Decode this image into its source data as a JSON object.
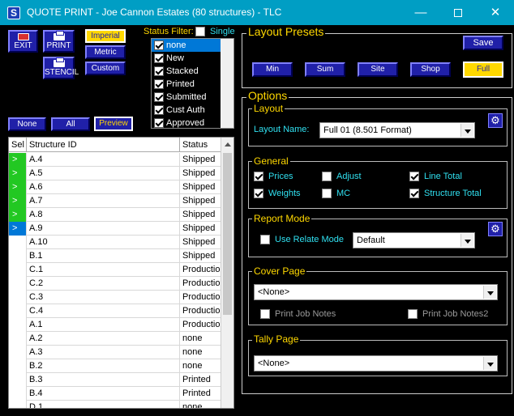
{
  "window": {
    "title": "QUOTE PRINT - Joe Cannon Estates (80 structures) - TLC",
    "minimize": "—",
    "close": "✕"
  },
  "toolbar": {
    "exit_label": "EXIT",
    "print_label": "PRINT",
    "stencil_label": "STENCIL",
    "imperial_label": "Imperial",
    "metric_label": "Metric",
    "custom_label": "Custom"
  },
  "status_filter": {
    "label": "Status Filter:",
    "single_label": "Single",
    "items": [
      {
        "label": "none",
        "selected": true
      },
      {
        "label": "New",
        "selected": false
      },
      {
        "label": "Stacked",
        "selected": false
      },
      {
        "label": "Printed",
        "selected": false
      },
      {
        "label": "Submitted",
        "selected": false
      },
      {
        "label": "Cust Auth",
        "selected": false
      },
      {
        "label": "Approved",
        "selected": false
      }
    ]
  },
  "selection_buttons": {
    "none_label": "None",
    "all_label": "All",
    "preview_label": "Preview"
  },
  "grid": {
    "columns": [
      "Sel",
      "Structure ID",
      "Status"
    ],
    "rows": [
      {
        "sel": ">",
        "sel_color": "green",
        "id": "A.4",
        "status": "Shipped"
      },
      {
        "sel": ">",
        "sel_color": "green",
        "id": "A.5",
        "status": "Shipped"
      },
      {
        "sel": ">",
        "sel_color": "green",
        "id": "A.6",
        "status": "Shipped"
      },
      {
        "sel": ">",
        "sel_color": "green",
        "id": "A.7",
        "status": "Shipped"
      },
      {
        "sel": ">",
        "sel_color": "green",
        "id": "A.8",
        "status": "Shipped"
      },
      {
        "sel": ">",
        "sel_color": "blue",
        "id": "A.9",
        "status": "Shipped"
      },
      {
        "sel": "",
        "sel_color": "none",
        "id": "A.10",
        "status": "Shipped"
      },
      {
        "sel": "",
        "sel_color": "none",
        "id": "B.1",
        "status": "Shipped"
      },
      {
        "sel": "",
        "sel_color": "none",
        "id": "C.1",
        "status": "Production"
      },
      {
        "sel": "",
        "sel_color": "none",
        "id": "C.2",
        "status": "Production"
      },
      {
        "sel": "",
        "sel_color": "none",
        "id": "C.3",
        "status": "Production"
      },
      {
        "sel": "",
        "sel_color": "none",
        "id": "C.4",
        "status": "Production"
      },
      {
        "sel": "",
        "sel_color": "none",
        "id": "A.1",
        "status": "Production"
      },
      {
        "sel": "",
        "sel_color": "none",
        "id": "A.2",
        "status": "none"
      },
      {
        "sel": "",
        "sel_color": "none",
        "id": "A.3",
        "status": "none"
      },
      {
        "sel": "",
        "sel_color": "none",
        "id": "B.2",
        "status": "none"
      },
      {
        "sel": "",
        "sel_color": "none",
        "id": "B.3",
        "status": "Printed"
      },
      {
        "sel": "",
        "sel_color": "none",
        "id": "B.4",
        "status": "Printed"
      },
      {
        "sel": "",
        "sel_color": "none",
        "id": "D.1",
        "status": "none"
      }
    ]
  },
  "layout_presets": {
    "title": "Layout Presets",
    "save_label": "Save",
    "min_label": "Min",
    "sum_label": "Sum",
    "site_label": "Site",
    "shop_label": "Shop",
    "full_label": "Full"
  },
  "options": {
    "title": "Options",
    "layout": {
      "title": "Layout",
      "name_label": "Layout Name:",
      "name_value": "Full 01 (8.501 Format)"
    },
    "general": {
      "title": "General",
      "prices": {
        "label": "Prices",
        "checked": true
      },
      "adjust": {
        "label": "Adjust",
        "checked": false
      },
      "line_total": {
        "label": "Line Total",
        "checked": true
      },
      "weights": {
        "label": "Weights",
        "checked": true
      },
      "mc": {
        "label": "MC",
        "checked": false
      },
      "structure_total": {
        "label": "Structure Total",
        "checked": true
      }
    },
    "report_mode": {
      "title": "Report Mode",
      "use_relate_label": "Use Relate Mode",
      "mode_value": "Default"
    },
    "cover_page": {
      "title": "Cover Page",
      "value": "<None>",
      "print_job_notes_label": "Print Job Notes",
      "print_job_notes2_label": "Print Job Notes2"
    },
    "tally_page": {
      "title": "Tally Page",
      "value": "<None>"
    }
  },
  "colors": {
    "titlebar": "#009ec4",
    "button_blue": "#2020a8",
    "accent_yellow": "#ffd800",
    "label_cyan": "#30e0f0",
    "sel_green": "#22c822",
    "sel_blue": "#0078d7"
  }
}
